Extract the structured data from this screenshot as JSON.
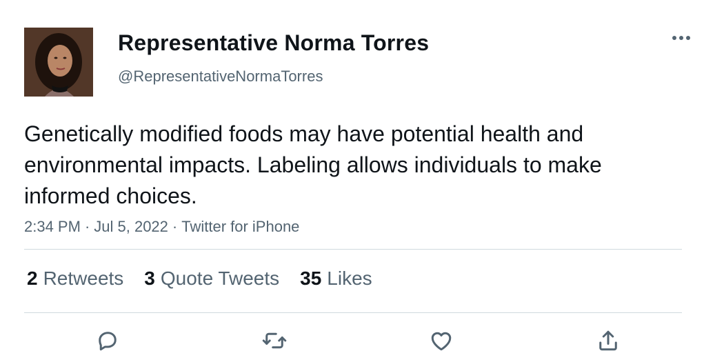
{
  "author": {
    "display_name": "Representative Norma Torres",
    "handle": "@RepresentativeNormaTorres",
    "avatar_icon": "profile-photo"
  },
  "tweet": {
    "text": "Genetically modified foods may have potential health and environmental impacts. Labeling allows individuals to make informed choices.",
    "time": "2:34 PM",
    "date": "Jul 5, 2022",
    "source": "Twitter for iPhone",
    "separator": "·"
  },
  "stats": {
    "retweets_count": "2",
    "retweets_label": "Retweets",
    "quotes_count": "3",
    "quotes_label": "Quote Tweets",
    "likes_count": "35",
    "likes_label": "Likes"
  },
  "actions": [
    "reply-icon",
    "retweet-icon",
    "like-icon",
    "share-icon"
  ],
  "colors": {
    "text_primary": "#0f1419",
    "text_secondary": "#536471",
    "divider": "#cfd9de"
  }
}
